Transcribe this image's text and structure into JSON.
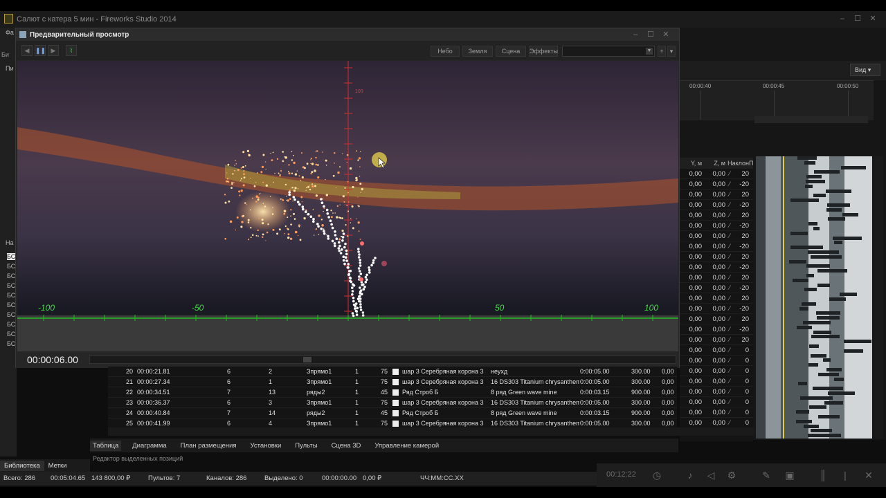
{
  "main_window": {
    "title": "Салют с катера 5 мин - Fireworks Studio 2014"
  },
  "left_panel": {
    "labels": [
      "Фа",
      "Би",
      "Пи",
      "На",
      "БС",
      "БС",
      "БС",
      "БС",
      "БС",
      "БС",
      "БС",
      "БС",
      "БС",
      "БС"
    ]
  },
  "preview": {
    "title": "Предварительный просмотр",
    "buttons": [
      "Небо",
      "Земля",
      "Сцена",
      "Эффекты"
    ],
    "time": "00:00:06.00",
    "axis_labels": [
      "-100",
      "-50",
      "50",
      "100"
    ],
    "vertical_label": "100"
  },
  "right": {
    "view_button": "Вид",
    "timeline_ticks": [
      "00:00:40",
      "00:00:45",
      "00:00:50"
    ],
    "headers": [
      "Y, м",
      "Z, м",
      "Наклон",
      "П"
    ],
    "rows": [
      {
        "y": "0,00",
        "z": "0,00",
        "n": "20"
      },
      {
        "y": "0,00",
        "z": "0,00",
        "n": "-20"
      },
      {
        "y": "0,00",
        "z": "0,00",
        "n": "20"
      },
      {
        "y": "0,00",
        "z": "0,00",
        "n": "-20"
      },
      {
        "y": "0,00",
        "z": "0,00",
        "n": "20"
      },
      {
        "y": "0,00",
        "z": "0,00",
        "n": "-20"
      },
      {
        "y": "0,00",
        "z": "0,00",
        "n": "20"
      },
      {
        "y": "0,00",
        "z": "0,00",
        "n": "-20"
      },
      {
        "y": "0,00",
        "z": "0,00",
        "n": "20"
      },
      {
        "y": "0,00",
        "z": "0,00",
        "n": "-20"
      },
      {
        "y": "0,00",
        "z": "0,00",
        "n": "20"
      },
      {
        "y": "0,00",
        "z": "0,00",
        "n": "-20"
      },
      {
        "y": "0,00",
        "z": "0,00",
        "n": "20"
      },
      {
        "y": "0,00",
        "z": "0,00",
        "n": "-20"
      },
      {
        "y": "0,00",
        "z": "0,00",
        "n": "20"
      },
      {
        "y": "0,00",
        "z": "0,00",
        "n": "-20"
      },
      {
        "y": "0,00",
        "z": "0,00",
        "n": "20"
      },
      {
        "y": "0,00",
        "z": "0,00",
        "n": "0"
      },
      {
        "y": "0,00",
        "z": "0,00",
        "n": "0"
      },
      {
        "y": "0,00",
        "z": "0,00",
        "n": "0"
      },
      {
        "y": "0,00",
        "z": "0,00",
        "n": "0"
      },
      {
        "y": "0,00",
        "z": "0,00",
        "n": "0"
      },
      {
        "y": "0,00",
        "z": "0,00",
        "n": "0"
      },
      {
        "y": "0,00",
        "z": "0,00",
        "n": "0"
      },
      {
        "y": "0,00",
        "z": "0,00",
        "n": "0"
      }
    ]
  },
  "positions": [
    {
      "n": "20",
      "time": "00:00:21.81",
      "a": "6",
      "b": "2",
      "name": "Зпрямо1",
      "c": "1",
      "d": "75",
      "item": "шар 3 Серебряная корона  3",
      "effect": "неухд",
      "dur": "0:00:05.00",
      "h": "300.00",
      "z": "0,00"
    },
    {
      "n": "21",
      "time": "00:00:27.34",
      "a": "6",
      "b": "1",
      "name": "Зпрямо1",
      "c": "1",
      "d": "75",
      "item": "шар 3 Серебряная корона  3",
      "effect": "16 DS303 Titanium chrysanthem",
      "dur": "0:00:05.00",
      "h": "300.00",
      "z": "0,00"
    },
    {
      "n": "22",
      "time": "00:00:34.51",
      "a": "7",
      "b": "13",
      "name": "ряды2",
      "c": "1",
      "d": "45",
      "item": "Ряд Строб Б",
      "effect": "8 ряд Green wave mine",
      "dur": "0:00:03.15",
      "h": "900.00",
      "z": "0,00"
    },
    {
      "n": "23",
      "time": "00:00:36.37",
      "a": "6",
      "b": "3",
      "name": "Зпрямо1",
      "c": "1",
      "d": "75",
      "item": "шар 3 Серебряная корона  3",
      "effect": "16 DS303 Titanium chrysanthem",
      "dur": "0:00:05.00",
      "h": "300.00",
      "z": "0,00"
    },
    {
      "n": "24",
      "time": "00:00:40.84",
      "a": "7",
      "b": "14",
      "name": "ряды2",
      "c": "1",
      "d": "45",
      "item": "Ряд Строб Б",
      "effect": "8 ряд Green wave mine",
      "dur": "0:00:03.15",
      "h": "900.00",
      "z": "0,00"
    },
    {
      "n": "25",
      "time": "00:00:41.99",
      "a": "6",
      "b": "4",
      "name": "Зпрямо1",
      "c": "1",
      "d": "75",
      "item": "шар 3 Серебряная корона  3",
      "effect": "16 DS303 Titanium chrysanthem",
      "dur": "0:00:05.00",
      "h": "300.00",
      "z": "0,00"
    }
  ],
  "tabs": [
    "Таблица",
    "Диаграмма",
    "План размещения",
    "Установки",
    "Пульты",
    "Сцена 3D",
    "Управление камерой"
  ],
  "editor_label": "Редактор выделенных позиций",
  "left_tabs": [
    "Библиотека",
    "Метки"
  ],
  "status": {
    "total": "Всего: 286",
    "duration": "00:05:04.65",
    "sum": "143 800,00 ₽",
    "panels": "Пультов: 7",
    "channels": "Каналов: 286",
    "selected": "Выделено: 0",
    "sel_time": "00:00:00.00",
    "sel_sum": "0,00 ₽",
    "format": "ЧЧ:ММ:СС.ХХ"
  },
  "transport": {
    "time": "00:12:22"
  },
  "icons": [
    "app-icon",
    "preview-icon",
    "rewind-icon",
    "pause-icon",
    "forward-icon",
    "chart-icon",
    "minimize-icon",
    "maximize-icon",
    "close-icon",
    "timer-icon",
    "microphone-icon",
    "speaker-icon",
    "settings-icon",
    "pencil-icon",
    "camera-icon",
    "split-icon",
    "cut-icon"
  ]
}
